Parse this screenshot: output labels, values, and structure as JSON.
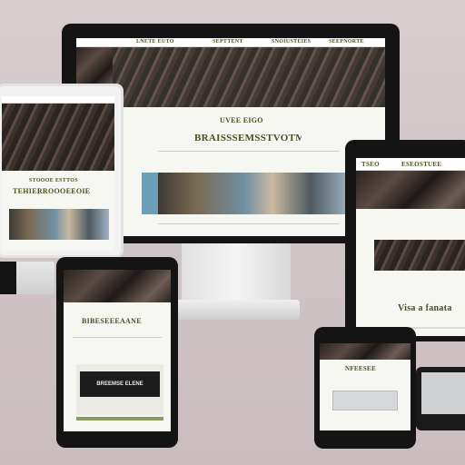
{
  "monitor": {
    "nav_brand": "LNETE EUTO",
    "nav_links": [
      "SEPTTENT",
      "SNOIUSTEIES",
      "SEEPNORTE"
    ],
    "subtitle": "UVEE EIGO",
    "headline": "BRAISSSEMSSTVOTM",
    "accent_color": "#4a4f1e"
  },
  "laptop": {
    "nav_brand": "STOOOE ESTTOS",
    "headline": "TEHIERROOOEEOIE"
  },
  "tablet_right": {
    "nav_brand": "TSEO",
    "nav_title": "ESEOSTUEE",
    "headline": "Visa a fanata"
  },
  "tablet_center": {
    "headline": "BIBESEEEAANE",
    "button_label": "BREEMSE ELENE"
  },
  "phone": {
    "headline": "NFEESEE"
  }
}
